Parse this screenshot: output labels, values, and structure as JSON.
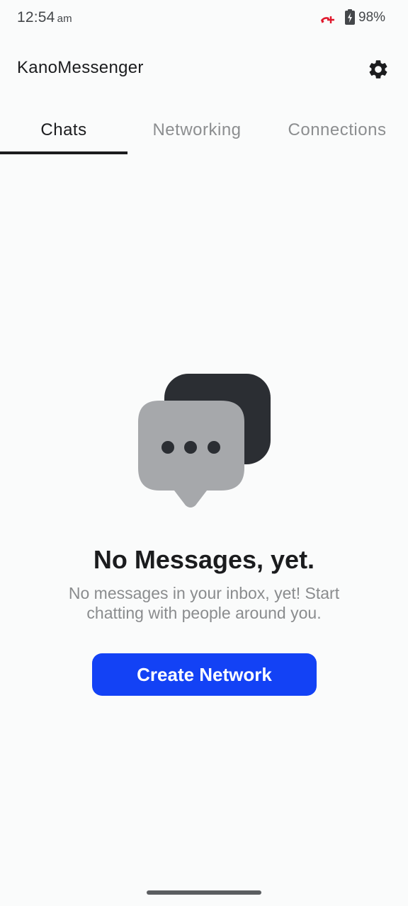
{
  "status_bar": {
    "time": "12:54",
    "ampm": "am",
    "battery": "98%",
    "icons": [
      "missed-call-icon",
      "battery-charging-icon"
    ],
    "call_icon_color": "#e0182c"
  },
  "header": {
    "title": "KanoMessenger",
    "settings_icon": "gear-icon"
  },
  "tabs": [
    {
      "label": "Chats",
      "active": true
    },
    {
      "label": "Networking",
      "active": false
    },
    {
      "label": "Connections",
      "active": false
    }
  ],
  "empty_state": {
    "icon": "chat-bubbles-icon",
    "title": "No Messages, yet.",
    "line1": "No messages in your inbox, yet! Start",
    "line2": "chatting with people around you.",
    "button_label": "Create Network"
  },
  "colors": {
    "accent": "#1342f5",
    "background": "#fafbfb",
    "text_primary": "#1b1c1e",
    "text_secondary": "#8a8c8e"
  }
}
